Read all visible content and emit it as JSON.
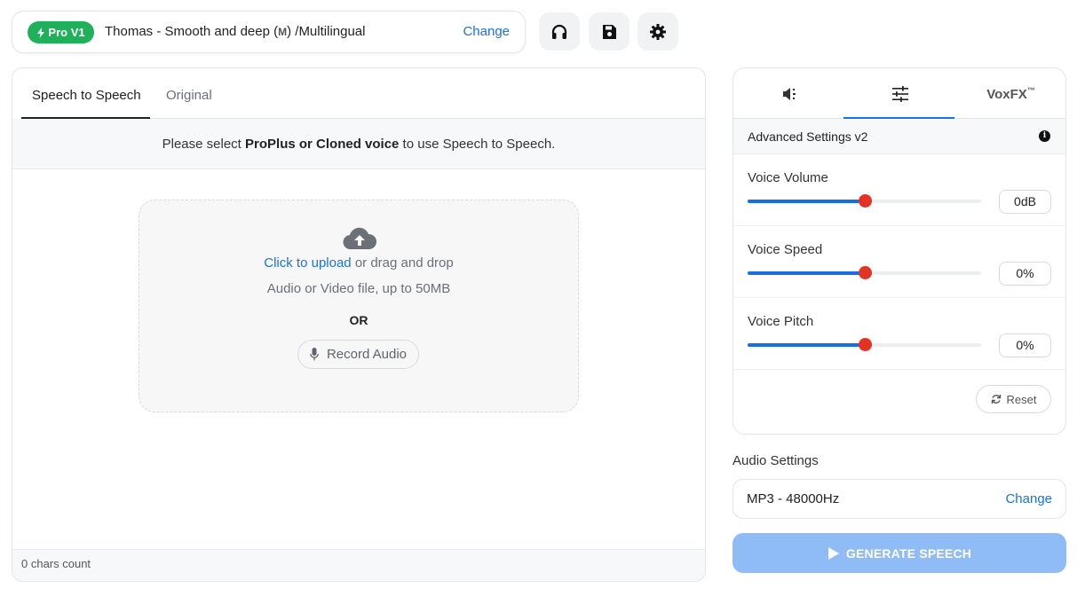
{
  "header": {
    "badge": "Pro V1",
    "voice_name": "Thomas - Smooth and deep (",
    "voice_tag": "M",
    "voice_suffix": ") /Multilingual",
    "change_label": "Change",
    "icons": [
      "headphones-icon",
      "save-icon",
      "gear-icon"
    ]
  },
  "left": {
    "tabs": [
      "Speech to Speech",
      "Original"
    ],
    "active_tab": "Speech to Speech",
    "notice_prefix": "Please select ",
    "notice_bold": "ProPlus or Cloned voice",
    "notice_suffix": " to use Speech to Speech.",
    "upload_link": "Click to upload",
    "upload_rest": " or drag and drop",
    "file_hint": "Audio or Video file, up to 50MB",
    "or_label": "OR",
    "record_label": "Record Audio",
    "chars_count": "0 chars count"
  },
  "right": {
    "tabs": [
      "speaker-icon",
      "sliders-icon",
      "VoxFX"
    ],
    "voxfx_label": "VoxFX",
    "voxfx_mark": "™",
    "active_tab": 1,
    "advanced_title": "Advanced Settings v2",
    "sliders": [
      {
        "label": "Voice Volume",
        "value": "0dB",
        "level": 0.5
      },
      {
        "label": "Voice Speed",
        "value": "0%",
        "level": 0.5
      },
      {
        "label": "Voice Pitch",
        "value": "0%",
        "level": 0.5
      }
    ],
    "reset_label": "Reset"
  },
  "audio": {
    "label": "Audio Settings",
    "value": "MP3 - 48000Hz",
    "change_label": "Change"
  },
  "generate_label": "GENERATE SPEECH",
  "colors": {
    "accent": "#1a73e8",
    "badge": "#1fb05a",
    "slider_thumb": "#e53222",
    "generate_disabled": "#8fbcf7"
  }
}
